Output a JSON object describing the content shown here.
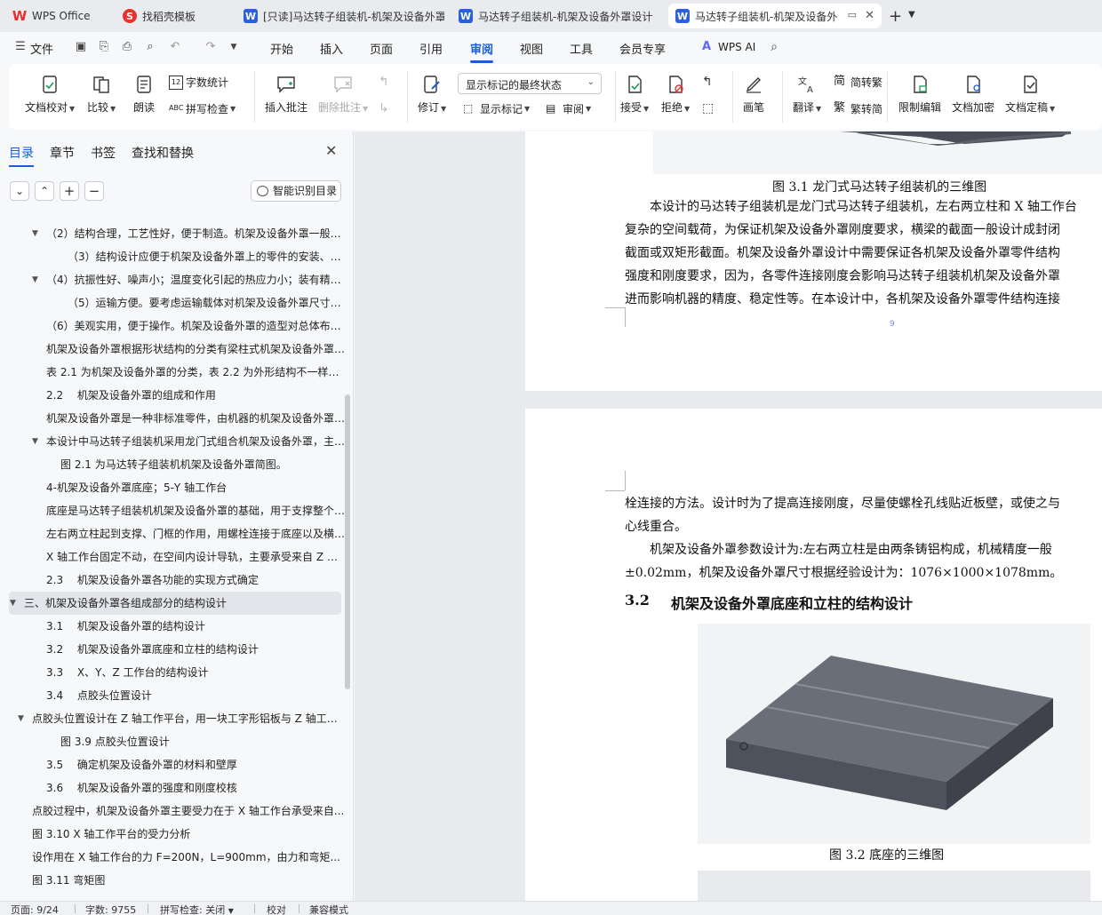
{
  "tabs": [
    {
      "label": "WPS Office",
      "icon": "wps-logo-icon",
      "color": "#e8302d"
    },
    {
      "label": "找稻壳模板",
      "icon": "docer-icon",
      "color": "#e8302d"
    },
    {
      "label": "[只读]马达转子组装机-机架及设备外罩",
      "icon": "word-doc-icon",
      "color": "#2b5fdb"
    },
    {
      "label": "马达转子组装机-机架及设备外罩设计",
      "icon": "word-doc-icon",
      "color": "#2b5fdb"
    },
    {
      "label": "马达转子组装机-机架及设备外",
      "icon": "word-doc-icon",
      "color": "#2b5fdb"
    }
  ],
  "menu": {
    "file": "文件",
    "items": [
      "开始",
      "插入",
      "页面",
      "引用",
      "审阅",
      "视图",
      "工具",
      "会员专享"
    ],
    "active": "审阅",
    "wps_ai": "WPS AI"
  },
  "ribbon": {
    "doc_check": "文档校对",
    "compare": "比较",
    "read_aloud": "朗读",
    "word_count": "字数统计",
    "spell_check": "拼写检查",
    "insert_comment": "插入批注",
    "delete_comment": "删除批注",
    "revise": "修订",
    "show_markup": "显示标记",
    "review": "审阅",
    "track_state": "显示标记的最终状态",
    "accept": "接受",
    "reject": "拒绝",
    "ink": "画笔",
    "translate": "翻译",
    "to_traditional": "简转繁",
    "to_simplified": "繁转简",
    "restrict_edit": "限制编辑",
    "encrypt": "文档加密",
    "finalize": "文档定稿"
  },
  "nav": {
    "tabs": [
      "目录",
      "章节",
      "书签",
      "查找和替换"
    ],
    "smart_button": "智能识别目录",
    "toc": [
      {
        "text": "（2）结构合理，工艺性好，便于制造。机架及设备外罩一般都是...",
        "indent": 52,
        "toggle": "▼"
      },
      {
        "text": "（3）结构设计应便于机架及设备外罩上的零件的安装、调整与修理...",
        "indent": 76
      },
      {
        "text": "（4）抗振性好、噪声小；温度变化引起的热应力小；装有精密...",
        "indent": 52,
        "toggle": "▼"
      },
      {
        "text": "（5）运输方便。要考虑运输载体对机架及设备外罩尺寸的限制...",
        "indent": 76
      },
      {
        "text": "（6）美观实用，便于操作。机架及设备外罩的造型对总体布置...",
        "indent": 52
      },
      {
        "text": "机架及设备外罩根据形状结构的分类有梁柱式机架及设备外罩、框架式...",
        "indent": 52
      },
      {
        "text": "表 2.1 为机架及设备外罩的分类，表 2.2 为外形结构不一样的机架...",
        "indent": 52
      },
      {
        "text": "2.2　 机架及设备外罩的组成和作用",
        "indent": 52
      },
      {
        "text": "机架及设备外罩是一种非标准零件，由机器的机架及设备外罩组成...",
        "indent": 52
      },
      {
        "text": "本设计中马达转子组装机采用龙门式组合机架及设备外罩，主要由...",
        "indent": 52,
        "toggle": "▼"
      },
      {
        "text": "图 2.1 为马达转子组装机机架及设备外罩简图。",
        "indent": 68
      },
      {
        "text": "4-机架及设备外罩底座；5-Y 轴工作台",
        "indent": 52
      },
      {
        "text": "底座是马达转子组装机机架及设备外罩的基础，用于支撑整个机器...",
        "indent": 52
      },
      {
        "text": "左右两立柱起到支撑、门框的作用，用螺栓连接于底座以及横梁...",
        "indent": 52
      },
      {
        "text": "X 轴工作台固定不动，在空间内设计导轨，主要承受来自 Z 轴工作台...",
        "indent": 52
      },
      {
        "text": "2.3　 机架及设备外罩各功能的实现方式确定",
        "indent": 52
      },
      {
        "text": "三、机架及设备外罩各组成部分的结构设计",
        "indent": 27,
        "toggle": "▼",
        "selected": true
      },
      {
        "text": "3.1　 机架及设备外罩的结构设计",
        "indent": 52
      },
      {
        "text": "3.2　 机架及设备外罩底座和立柱的结构设计",
        "indent": 52
      },
      {
        "text": "3.3　 X、Y、Z 工作台的结构设计",
        "indent": 52
      },
      {
        "text": "3.4　 点胶头位置设计",
        "indent": 52
      },
      {
        "text": "点胶头位置设计在 Z 轴工作平台，用一块工字形铝板与 Z 轴工作台...",
        "indent": 36,
        "toggle": "▼"
      },
      {
        "text": "图 3.9  点胶头位置设计",
        "indent": 68
      },
      {
        "text": "3.5　 确定机架及设备外罩的材料和壁厚",
        "indent": 52
      },
      {
        "text": "3.6　 机架及设备外罩的强度和刚度校核",
        "indent": 52
      },
      {
        "text": "点胶过程中，机架及设备外罩主要受力在于 X 轴工作台承受来自...",
        "indent": 36
      },
      {
        "text": "图 3.10 X 轴工作平台的受力分析",
        "indent": 36
      },
      {
        "text": "设作用在 X 轴工作台的力 F=200N，L=900mm，由力和弯矩...",
        "indent": 36
      },
      {
        "text": "图 3.11  弯矩图",
        "indent": 36
      }
    ]
  },
  "doc": {
    "page1": {
      "caption": "图 3.1  龙门式马达转子组装机的三维图",
      "lines": [
        "　　本设计的马达转子组装机是龙门式马达转子组装机，左右两立柱和 X 轴工作台",
        "复杂的空间载荷，为保证机架及设备外罩刚度要求，横梁的截面一般设计成封闭",
        "截面或双矩形截面。机架及设备外罩设计中需要保证各机架及设备外罩零件结构",
        "强度和刚度要求，因为，各零件连接刚度会影响马达转子组装机机架及设备外罩",
        "进而影响机器的精度、稳定性等。在本设计中，各机架及设备外罩零件结构连接"
      ],
      "page_number": "9"
    },
    "page2": {
      "lines": [
        "栓连接的方法。设计时为了提高连接刚度，尽量使螺栓孔线贴近板壁，或使之与",
        "心线重合。",
        "　　机架及设备外罩参数设计为:左右两立柱是由两条铸铝构成，机械精度一般",
        "±0.02mm，机架及设备外罩尺寸根据经验设计为：1076×1000×1078mm。"
      ],
      "heading_num": "3.2",
      "heading": "机架及设备外罩底座和立柱的结构设计",
      "caption": "图 3.2  底座的三维图"
    }
  },
  "status": {
    "page": "页面: 9/24",
    "words": "字数: 9755",
    "spell": "拼写检查: 关闭",
    "proof": "校对",
    "compat": "兼容模式"
  }
}
